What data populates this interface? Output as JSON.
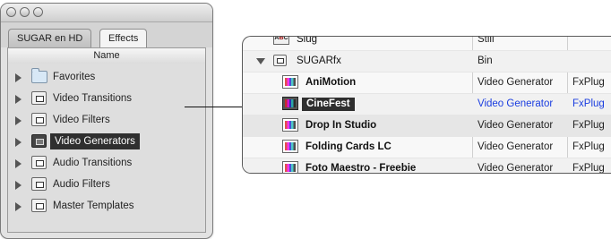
{
  "left_window": {
    "tabs": [
      "SUGAR en HD",
      "Effects"
    ],
    "active_tab": "Effects",
    "column_header": "Name",
    "items": [
      {
        "label": "Favorites",
        "icon": "folder-icon"
      },
      {
        "label": "Video Transitions",
        "icon": "bin-icon"
      },
      {
        "label": "Video Filters",
        "icon": "bin-icon"
      },
      {
        "label": "Video Generators",
        "icon": "bin-icon",
        "selected": true
      },
      {
        "label": "Audio Transitions",
        "icon": "bin-icon"
      },
      {
        "label": "Audio Filters",
        "icon": "bin-icon"
      },
      {
        "label": "Master Templates",
        "icon": "bin-icon"
      }
    ]
  },
  "right_panel": {
    "rows": [
      {
        "name": "Slug",
        "type": "Still",
        "ext": "",
        "icon": "slug-icon"
      },
      {
        "name": "SUGARfx",
        "type": "Bin",
        "ext": "",
        "icon": "bin-icon"
      },
      {
        "name": "AniMotion",
        "type": "Video Generator",
        "ext": "FxPlug",
        "icon": "generator-icon"
      },
      {
        "name": "CineFest",
        "type": "Video Generator",
        "ext": "FxPlug",
        "icon": "generator-icon",
        "selected": true
      },
      {
        "name": "Drop In Studio",
        "type": "Video Generator",
        "ext": "FxPlug",
        "icon": "generator-icon"
      },
      {
        "name": "Folding Cards LC",
        "type": "Video Generator",
        "ext": "FxPlug",
        "icon": "generator-icon"
      },
      {
        "name": "Foto Maestro - Freebie",
        "type": "Video Generator",
        "ext": "FxPlug",
        "icon": "generator-icon"
      }
    ]
  },
  "colors": {
    "selection_bg": "#2f2f2f",
    "selected_link_text": "#1a3de0"
  }
}
